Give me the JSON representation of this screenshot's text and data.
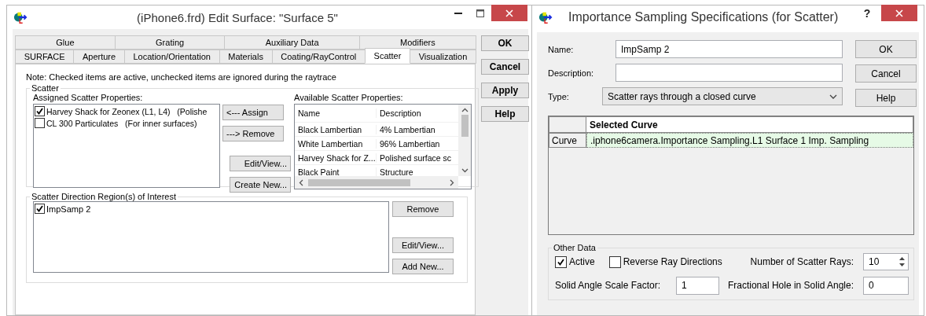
{
  "edit_surface_window": {
    "title": "(iPhone6.frd) Edit Surface: \"Surface 5\"",
    "tab_rows": [
      [
        {
          "label": "Glue",
          "selected": false
        },
        {
          "label": "Grating",
          "selected": false
        },
        {
          "label": "Auxiliary Data",
          "selected": false
        },
        {
          "label": "Modifiers",
          "selected": false
        }
      ],
      [
        {
          "label": "SURFACE",
          "selected": false
        },
        {
          "label": "Aperture",
          "selected": false
        },
        {
          "label": "Location/Orientation",
          "selected": false
        },
        {
          "label": "Materials",
          "selected": false
        },
        {
          "label": "Coating/RayControl",
          "selected": false
        },
        {
          "label": "Scatter",
          "selected": true
        },
        {
          "label": "Visualization",
          "selected": false
        }
      ]
    ],
    "note": "Note:  Checked items are active,  unchecked items are ignored during the raytrace",
    "scatter_group": {
      "title": "Scatter",
      "assigned_label": "Assigned Scatter Properties:",
      "assigned": [
        {
          "label": "Harvey Shack for Zeonex (L1, L4)   (Polishe",
          "checked": true
        },
        {
          "label": "CL 300 Particulates   (For inner surfaces)",
          "checked": false
        }
      ],
      "assign_button": "<--- Assign",
      "remove_button": "---> Remove",
      "edit_button": "Edit/View...",
      "create_button": "Create New...",
      "available_label": "Available Scatter Properties:",
      "available_table": {
        "columns": [
          "Name",
          "Description"
        ],
        "rows": [
          [
            "Black Lambertian",
            "4% Lambertian"
          ],
          [
            "White Lambertian",
            "96% Lambertian"
          ],
          [
            "Harvey Shack for Z...",
            "Polished surface sc"
          ],
          [
            "Black Paint",
            "Structure"
          ]
        ]
      }
    },
    "region_group": {
      "title": "Scatter Direction Region(s) of Interest",
      "items": [
        {
          "label": "ImpSamp 2",
          "checked": true
        }
      ],
      "remove_button": "Remove",
      "edit_button": "Edit/View...",
      "add_button": "Add New..."
    },
    "side_buttons": [
      "OK",
      "Cancel",
      "Apply",
      "Help"
    ]
  },
  "sampling_window": {
    "title": "Importance Sampling Specifications (for Scatter)",
    "help_glyph": "?",
    "name": {
      "label": "Name:",
      "value": "ImpSamp 2"
    },
    "description": {
      "label": "Description:"
    },
    "type": {
      "label": "Type:",
      "value": "Scatter rays through a closed curve"
    },
    "buttons": [
      "OK",
      "Cancel",
      "Help"
    ],
    "curve_table": {
      "header": "Selected Curve",
      "rows": [
        {
          "label": "Curve",
          "value": ".iphone6camera.Importance Sampling.L1 Surface 1 Imp. Sampling"
        }
      ]
    },
    "other_data": {
      "title": "Other Data",
      "options": [
        {
          "label": "Active",
          "checked": true
        },
        {
          "label": "Reverse Ray Directions",
          "checked": false
        }
      ],
      "scatter_rays": {
        "label": "Number of Scatter Rays:",
        "value": "10"
      },
      "scale_factor": {
        "label": "Solid Angle Scale Factor:",
        "value": "1"
      },
      "hole": {
        "label": "Fractional Hole in Solid Angle:",
        "value": "0"
      }
    }
  }
}
